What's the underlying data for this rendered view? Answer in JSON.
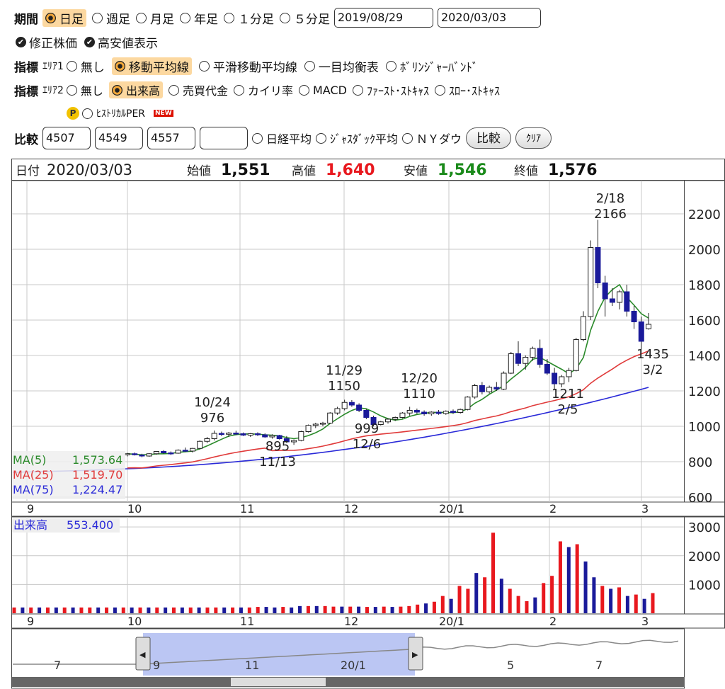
{
  "controls": {
    "period_label": "期間",
    "period_options": [
      "日足",
      "週足",
      "月足",
      "年足",
      "１分足",
      "５分足"
    ],
    "period_selected": 0,
    "date_from": "2019/08/29",
    "date_to": "2020/03/03",
    "adjusted_label": "修正株価",
    "hilo_label": "高安値表示",
    "indicator_label": "指標",
    "area1_label": "ｴﾘｱ1",
    "area1_options": [
      "無し",
      "移動平均線",
      "平滑移動平均線",
      "一目均衡表",
      "ﾎﾞﾘﾝｼﾞｬｰﾊﾞﾝﾄﾞ"
    ],
    "area1_selected": 1,
    "area2_label": "ｴﾘｱ2",
    "area2_options": [
      "無し",
      "出来高",
      "売買代金",
      "カイリ率",
      "MACD",
      "ﾌｧｰｽﾄ･ｽﾄｷｬｽ",
      "ｽﾛｰ･ｽﾄｷｬｽ"
    ],
    "area2_selected": 1,
    "per_badge": "P",
    "per_label": "ﾋｽﾄﾘｶﾙPER",
    "new_badge": "NEW",
    "compare_label": "比較",
    "compare_codes": [
      "4507",
      "4549",
      "4557",
      ""
    ],
    "compare_options": [
      "日経平均",
      "ｼﾞｬｽﾀﾞｯｸ平均",
      "ＮＹダウ"
    ],
    "compare_button": "比較",
    "clear_button": "ｸﾘｱ"
  },
  "quote": {
    "date_label": "日付",
    "date": "2020/03/03",
    "open_label": "始値",
    "open": "1,551",
    "high_label": "高値",
    "high": "1,640",
    "low_label": "安値",
    "low": "1,546",
    "close_label": "終値",
    "close": "1,576"
  },
  "colors": {
    "up": "#e8181e",
    "down": "#1a1a9a",
    "ma5": "#2a8a2a",
    "ma25": "#e03a3a",
    "ma75": "#2a2ad8",
    "grid": "#c8c8c8",
    "volume_up": "#e8181e",
    "volume_down": "#1a1a9a",
    "nav_fill": "#aab8f0"
  },
  "chart_data": {
    "type": "candlestick",
    "x_tick_labels": [
      "9",
      "10",
      "11",
      "12",
      "20/1",
      "2",
      "3"
    ],
    "y_ticks": [
      600,
      800,
      1000,
      1200,
      1400,
      1600,
      1800,
      2000,
      2200
    ],
    "ylim": [
      580,
      2380
    ],
    "ma_legend": [
      {
        "name": "MA(5)",
        "value": "1,573.64"
      },
      {
        "name": "MA(25)",
        "value": "1,519.70"
      },
      {
        "name": "MA(75)",
        "value": "1,224.47"
      }
    ],
    "annotations": [
      {
        "label": "10/24",
        "value": "976"
      },
      {
        "label": "11/13",
        "value": "895"
      },
      {
        "label": "11/29",
        "value": "1150"
      },
      {
        "label": "12/6",
        "value": "999"
      },
      {
        "label": "12/20",
        "value": "1110"
      },
      {
        "label": "2/5",
        "value": "1211"
      },
      {
        "label": "2/18",
        "value": "2166"
      },
      {
        "label": "3/2",
        "value": "1435"
      }
    ],
    "ohlc": [
      [
        840,
        850,
        830,
        845
      ],
      [
        845,
        852,
        835,
        840
      ],
      [
        838,
        845,
        825,
        832
      ],
      [
        832,
        848,
        828,
        845
      ],
      [
        845,
        860,
        840,
        858
      ],
      [
        858,
        865,
        845,
        850
      ],
      [
        850,
        858,
        838,
        848
      ],
      [
        848,
        870,
        845,
        865
      ],
      [
        865,
        880,
        855,
        860
      ],
      [
        860,
        878,
        852,
        875
      ],
      [
        875,
        920,
        870,
        915
      ],
      [
        915,
        940,
        905,
        930
      ],
      [
        930,
        976,
        920,
        960
      ],
      [
        960,
        970,
        945,
        955
      ],
      [
        955,
        968,
        940,
        962
      ],
      [
        962,
        975,
        950,
        958
      ],
      [
        958,
        965,
        945,
        950
      ],
      [
        950,
        962,
        940,
        958
      ],
      [
        958,
        966,
        945,
        952
      ],
      [
        952,
        960,
        935,
        940
      ],
      [
        940,
        955,
        930,
        948
      ],
      [
        948,
        952,
        925,
        930
      ],
      [
        930,
        945,
        905,
        912
      ],
      [
        912,
        925,
        895,
        920
      ],
      [
        920,
        975,
        915,
        970
      ],
      [
        970,
        1010,
        965,
        1005
      ],
      [
        1005,
        1020,
        990,
        1012
      ],
      [
        1012,
        1025,
        1000,
        1018
      ],
      [
        1018,
        1080,
        1015,
        1075
      ],
      [
        1075,
        1110,
        1065,
        1100
      ],
      [
        1100,
        1150,
        1090,
        1135
      ],
      [
        1135,
        1148,
        1110,
        1120
      ],
      [
        1120,
        1130,
        1080,
        1090
      ],
      [
        1090,
        1100,
        1040,
        1050
      ],
      [
        1050,
        1060,
        999,
        1010
      ],
      [
        1010,
        1030,
        1005,
        1025
      ],
      [
        1025,
        1045,
        1015,
        1040
      ],
      [
        1040,
        1055,
        1030,
        1050
      ],
      [
        1050,
        1080,
        1045,
        1075
      ],
      [
        1075,
        1110,
        1060,
        1090
      ],
      [
        1090,
        1100,
        1070,
        1080
      ],
      [
        1080,
        1090,
        1060,
        1070
      ],
      [
        1070,
        1085,
        1060,
        1080
      ],
      [
        1080,
        1092,
        1065,
        1072
      ],
      [
        1072,
        1090,
        1065,
        1085
      ],
      [
        1085,
        1095,
        1070,
        1078
      ],
      [
        1078,
        1100,
        1072,
        1095
      ],
      [
        1095,
        1170,
        1090,
        1165
      ],
      [
        1165,
        1240,
        1155,
        1230
      ],
      [
        1230,
        1250,
        1180,
        1195
      ],
      [
        1195,
        1230,
        1185,
        1220
      ],
      [
        1220,
        1250,
        1200,
        1210
      ],
      [
        1210,
        1310,
        1205,
        1300
      ],
      [
        1300,
        1420,
        1295,
        1410
      ],
      [
        1410,
        1480,
        1340,
        1355
      ],
      [
        1355,
        1400,
        1320,
        1390
      ],
      [
        1390,
        1450,
        1370,
        1440
      ],
      [
        1440,
        1490,
        1330,
        1350
      ],
      [
        1350,
        1380,
        1290,
        1300
      ],
      [
        1300,
        1330,
        1211,
        1240
      ],
      [
        1240,
        1290,
        1220,
        1280
      ],
      [
        1280,
        1330,
        1250,
        1315
      ],
      [
        1315,
        1500,
        1310,
        1490
      ],
      [
        1490,
        1650,
        1480,
        1620
      ],
      [
        1620,
        2050,
        1600,
        2010
      ],
      [
        2010,
        2166,
        1780,
        1810
      ],
      [
        1810,
        1850,
        1620,
        1720
      ],
      [
        1720,
        1780,
        1680,
        1700
      ],
      [
        1700,
        1770,
        1660,
        1760
      ],
      [
        1760,
        1800,
        1620,
        1650
      ],
      [
        1650,
        1680,
        1550,
        1590
      ],
      [
        1590,
        1620,
        1435,
        1480
      ],
      [
        1551,
        1640,
        1546,
        1576
      ]
    ],
    "volume_ylim": [
      0,
      3300
    ],
    "volume_ticks": [
      1000,
      2000,
      3000
    ],
    "volume_legend": {
      "name": "出来高",
      "value": "553.400"
    },
    "volume": [
      [
        200,
        1
      ],
      [
        200,
        0
      ],
      [
        200,
        1
      ],
      [
        200,
        0
      ],
      [
        200,
        1
      ],
      [
        200,
        0
      ],
      [
        200,
        1
      ],
      [
        200,
        0
      ],
      [
        200,
        1
      ],
      [
        200,
        1
      ],
      [
        200,
        0
      ],
      [
        200,
        1
      ],
      [
        200,
        0
      ],
      [
        200,
        1
      ],
      [
        200,
        0
      ],
      [
        200,
        1
      ],
      [
        200,
        0
      ],
      [
        200,
        1
      ],
      [
        200,
        0
      ],
      [
        200,
        1
      ],
      [
        200,
        0
      ],
      [
        200,
        1
      ],
      [
        200,
        0
      ],
      [
        200,
        1
      ],
      [
        200,
        1
      ],
      [
        200,
        0
      ],
      [
        200,
        1
      ],
      [
        200,
        0
      ],
      [
        200,
        1
      ],
      [
        220,
        1
      ],
      [
        220,
        0
      ],
      [
        200,
        0
      ],
      [
        220,
        1
      ],
      [
        200,
        0
      ],
      [
        250,
        0
      ],
      [
        250,
        1
      ],
      [
        250,
        0
      ],
      [
        250,
        1
      ],
      [
        230,
        1
      ],
      [
        230,
        0
      ],
      [
        230,
        1
      ],
      [
        230,
        0
      ],
      [
        220,
        1
      ],
      [
        220,
        0
      ],
      [
        230,
        1
      ],
      [
        220,
        0
      ],
      [
        230,
        1
      ],
      [
        250,
        1
      ],
      [
        300,
        1
      ],
      [
        340,
        0
      ],
      [
        400,
        1
      ],
      [
        600,
        1
      ],
      [
        500,
        0
      ],
      [
        950,
        1
      ],
      [
        850,
        1
      ],
      [
        1400,
        0
      ],
      [
        1250,
        1
      ],
      [
        2800,
        1
      ],
      [
        1200,
        0
      ],
      [
        850,
        1
      ],
      [
        600,
        1
      ],
      [
        420,
        1
      ],
      [
        550,
        0
      ],
      [
        1050,
        1
      ],
      [
        1300,
        1
      ],
      [
        2500,
        1
      ],
      [
        2300,
        0
      ],
      [
        2400,
        1
      ],
      [
        1800,
        0
      ],
      [
        1250,
        0
      ],
      [
        950,
        1
      ],
      [
        850,
        0
      ],
      [
        900,
        1
      ],
      [
        600,
        0
      ],
      [
        650,
        1
      ],
      [
        500,
        0
      ],
      [
        700,
        1
      ]
    ],
    "nav_tick_labels": [
      "7",
      "9",
      "11",
      "20/1",
      "5",
      "7"
    ]
  }
}
